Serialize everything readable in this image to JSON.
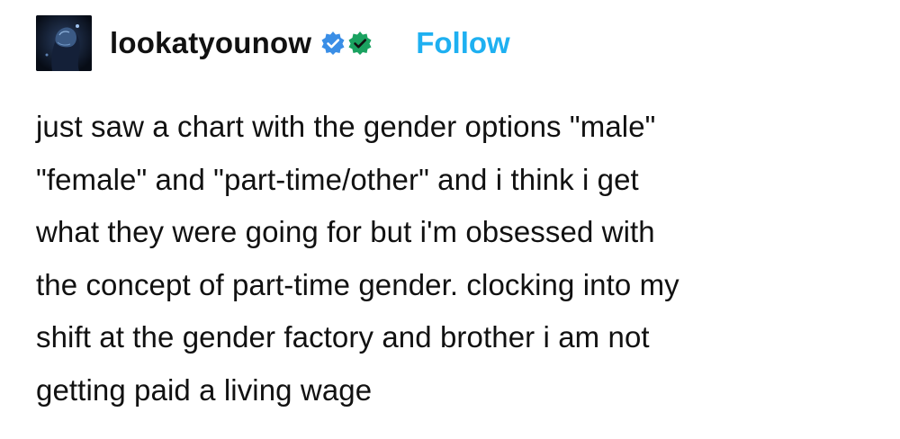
{
  "post": {
    "author": {
      "username": "lookatyounow",
      "avatar_icon": "avatar-image",
      "badges": [
        {
          "icon": "verified-checkmark-icon",
          "color": "#3a8ee6"
        },
        {
          "icon": "verified-checkmark-icon",
          "color": "#1aa260"
        }
      ]
    },
    "follow_label": "Follow",
    "follow_color": "#1eb0f1",
    "body_lines": [
      "just saw a chart with the gender options \"male\"",
      "\"female\" and \"part-time/other\" and i think i get",
      "what they were going for but i'm obsessed with",
      "the concept of part-time gender. clocking into my",
      "shift at the gender factory and brother i am not",
      "getting paid a living wage"
    ]
  }
}
